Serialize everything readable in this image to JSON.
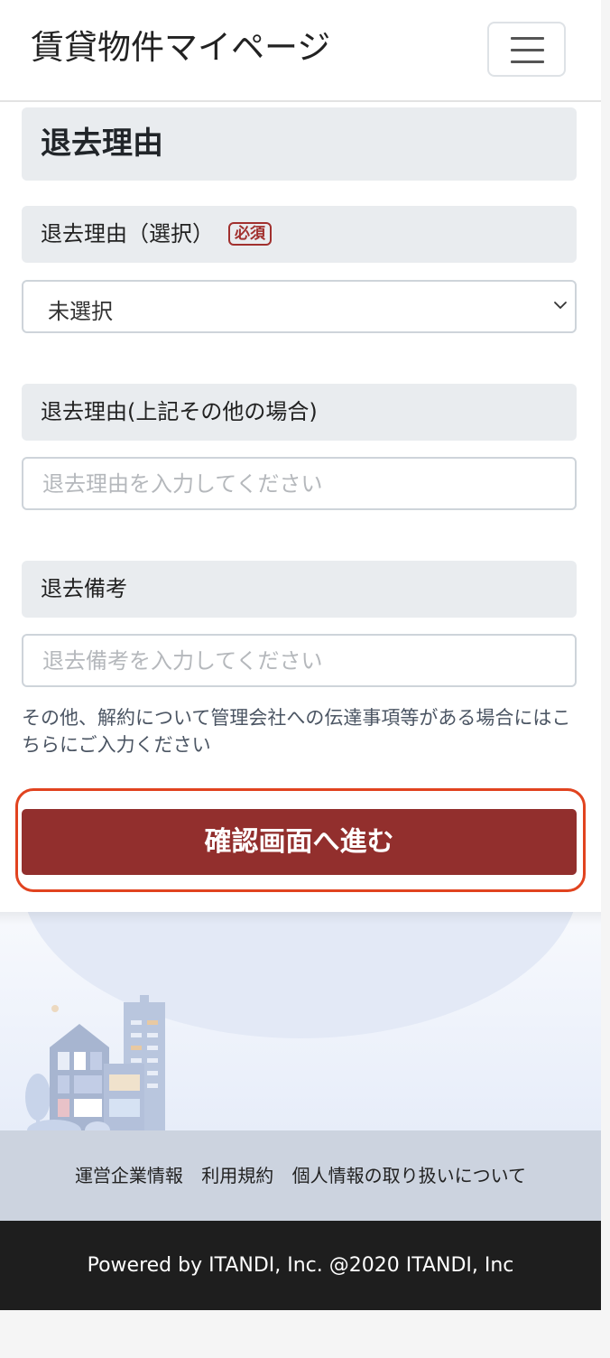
{
  "header": {
    "title": "賃貸物件マイページ",
    "menu_icon": "hamburger-menu-icon"
  },
  "form": {
    "section_title": "退去理由",
    "reason_select": {
      "label": "退去理由（選択）",
      "required_badge": "必須",
      "value": "未選択",
      "icon": "chevron-down-icon"
    },
    "reason_other": {
      "label": "退去理由(上記その他の場合)",
      "placeholder": "退去理由を入力してください",
      "value": ""
    },
    "remarks": {
      "label": "退去備考",
      "placeholder": "退去備考を入力してください",
      "value": ""
    },
    "help_text": "その他、解約について管理会社への伝達事項等がある場合にはこちらにご入力ください",
    "submit_label": "確認画面へ進む"
  },
  "footer": {
    "links": [
      "運営企業情報",
      "利用規約",
      "個人情報の取り扱いについて"
    ],
    "powered_by": "Powered by ITANDI, Inc. @2020 ITANDI, Inc"
  },
  "colors": {
    "primary": "#922f2d",
    "highlight": "#e1431f",
    "label_bg": "#e9ecef",
    "footer_links_bg": "#ccd3df",
    "footer_bg": "#1e1e1e"
  }
}
